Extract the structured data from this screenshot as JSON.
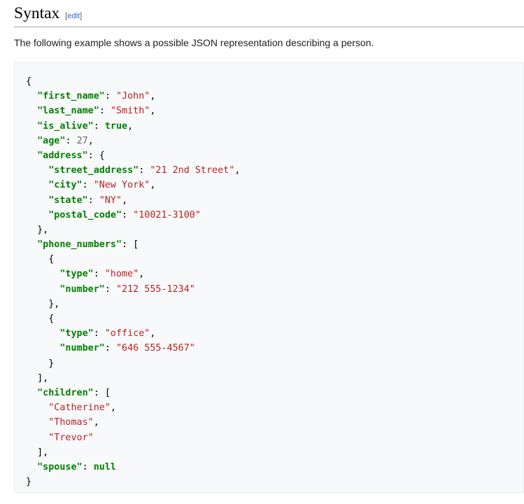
{
  "section": {
    "title": "Syntax",
    "edit_open": "[",
    "edit_label": "edit",
    "edit_close": "]"
  },
  "intro": "The following example shows a possible JSON representation describing a person.",
  "code_lines": [
    [
      [
        "p",
        "{"
      ]
    ],
    [
      [
        "p",
        "  "
      ],
      [
        "k",
        "\"first_name\""
      ],
      [
        "p",
        ": "
      ],
      [
        "s",
        "\"John\""
      ],
      [
        "p",
        ","
      ]
    ],
    [
      [
        "p",
        "  "
      ],
      [
        "k",
        "\"last_name\""
      ],
      [
        "p",
        ": "
      ],
      [
        "s",
        "\"Smith\""
      ],
      [
        "p",
        ","
      ]
    ],
    [
      [
        "p",
        "  "
      ],
      [
        "k",
        "\"is_alive\""
      ],
      [
        "p",
        ": "
      ],
      [
        "kw",
        "true"
      ],
      [
        "p",
        ","
      ]
    ],
    [
      [
        "p",
        "  "
      ],
      [
        "k",
        "\"age\""
      ],
      [
        "p",
        ": "
      ],
      [
        "n",
        "27"
      ],
      [
        "p",
        ","
      ]
    ],
    [
      [
        "p",
        "  "
      ],
      [
        "k",
        "\"address\""
      ],
      [
        "p",
        ": {"
      ]
    ],
    [
      [
        "p",
        "    "
      ],
      [
        "k",
        "\"street_address\""
      ],
      [
        "p",
        ": "
      ],
      [
        "s",
        "\"21 2nd Street\""
      ],
      [
        "p",
        ","
      ]
    ],
    [
      [
        "p",
        "    "
      ],
      [
        "k",
        "\"city\""
      ],
      [
        "p",
        ": "
      ],
      [
        "s",
        "\"New York\""
      ],
      [
        "p",
        ","
      ]
    ],
    [
      [
        "p",
        "    "
      ],
      [
        "k",
        "\"state\""
      ],
      [
        "p",
        ": "
      ],
      [
        "s",
        "\"NY\""
      ],
      [
        "p",
        ","
      ]
    ],
    [
      [
        "p",
        "    "
      ],
      [
        "k",
        "\"postal_code\""
      ],
      [
        "p",
        ": "
      ],
      [
        "s",
        "\"10021-3100\""
      ]
    ],
    [
      [
        "p",
        "  },"
      ]
    ],
    [
      [
        "p",
        "  "
      ],
      [
        "k",
        "\"phone_numbers\""
      ],
      [
        "p",
        ": ["
      ]
    ],
    [
      [
        "p",
        "    {"
      ]
    ],
    [
      [
        "p",
        "      "
      ],
      [
        "k",
        "\"type\""
      ],
      [
        "p",
        ": "
      ],
      [
        "s",
        "\"home\""
      ],
      [
        "p",
        ","
      ]
    ],
    [
      [
        "p",
        "      "
      ],
      [
        "k",
        "\"number\""
      ],
      [
        "p",
        ": "
      ],
      [
        "s",
        "\"212 555-1234\""
      ]
    ],
    [
      [
        "p",
        "    },"
      ]
    ],
    [
      [
        "p",
        "    {"
      ]
    ],
    [
      [
        "p",
        "      "
      ],
      [
        "k",
        "\"type\""
      ],
      [
        "p",
        ": "
      ],
      [
        "s",
        "\"office\""
      ],
      [
        "p",
        ","
      ]
    ],
    [
      [
        "p",
        "      "
      ],
      [
        "k",
        "\"number\""
      ],
      [
        "p",
        ": "
      ],
      [
        "s",
        "\"646 555-4567\""
      ]
    ],
    [
      [
        "p",
        "    }"
      ]
    ],
    [
      [
        "p",
        "  ],"
      ]
    ],
    [
      [
        "p",
        "  "
      ],
      [
        "k",
        "\"children\""
      ],
      [
        "p",
        ": ["
      ]
    ],
    [
      [
        "p",
        "    "
      ],
      [
        "s",
        "\"Catherine\""
      ],
      [
        "p",
        ","
      ]
    ],
    [
      [
        "p",
        "    "
      ],
      [
        "s",
        "\"Thomas\""
      ],
      [
        "p",
        ","
      ]
    ],
    [
      [
        "p",
        "    "
      ],
      [
        "s",
        "\"Trevor\""
      ]
    ],
    [
      [
        "p",
        "  ],"
      ]
    ],
    [
      [
        "p",
        "  "
      ],
      [
        "k",
        "\"spouse\""
      ],
      [
        "p",
        ": "
      ],
      [
        "kw",
        "null"
      ]
    ],
    [
      [
        "p",
        "}"
      ]
    ]
  ],
  "colors": {
    "key": "#008000",
    "string": "#ba2121",
    "number": "#666666",
    "link": "#3366cc",
    "code_background": "#f8f9fa"
  }
}
